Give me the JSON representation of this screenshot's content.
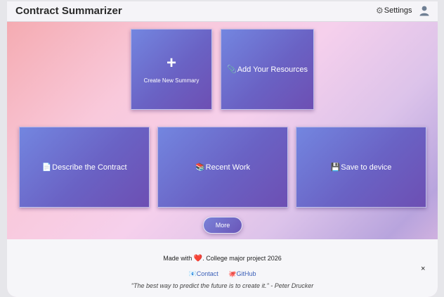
{
  "header": {
    "title": "Contract Summarizer",
    "settings_label": "Settings"
  },
  "cards": {
    "create": {
      "icon": "+",
      "label": "Create New Summary"
    },
    "resources": {
      "icon": "📎",
      "label": "Add Your Resources"
    },
    "describe": {
      "icon": "📄",
      "label": "Describe the Contract"
    },
    "recent": {
      "icon": "📚",
      "label": "Recent Work"
    },
    "save": {
      "icon": "💾",
      "label": "Save to device"
    }
  },
  "more_label": "More",
  "footer": {
    "made_prefix": "Made with",
    "heart": "❤️",
    "made_suffix": ". College major project 2026",
    "contact_icon": "📧",
    "contact_label": "Contact",
    "github_icon": "🐙",
    "github_label": "GitHub",
    "quote": "\"The best way to predict the future is to create it.\" - Peter Drucker",
    "close_label": "×"
  },
  "icons": {
    "settings": "gear-icon",
    "user": "user-icon"
  },
  "colors": {
    "card": "#6a62c4",
    "link": "#3a5fb8",
    "heart": "#e02a36"
  }
}
